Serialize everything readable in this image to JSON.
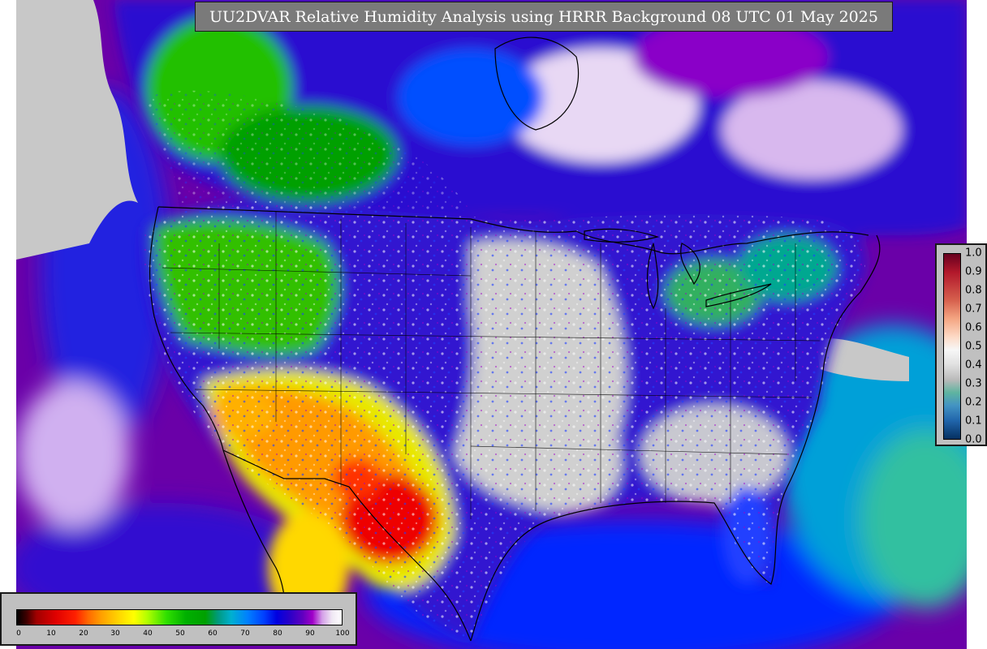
{
  "title": "UU2DVAR Relative Humidity Analysis using HRRR Background 08 UTC 01 May 2025",
  "map": {
    "variable": "Relative Humidity",
    "analysis": "UU2DVAR",
    "background": "HRRR",
    "valid_time": "08 UTC 01 May 2025",
    "region": "CONUS"
  },
  "rh_legend": {
    "ticks": [
      "0",
      "10",
      "20",
      "30",
      "40",
      "50",
      "60",
      "70",
      "80",
      "90",
      "100"
    ],
    "min": 0,
    "max": 100
  },
  "qc_legend": {
    "ticks": [
      "1.0",
      "0.9",
      "0.8",
      "0.7",
      "0.6",
      "0.5",
      "0.4",
      "0.3",
      "0.2",
      "0.1",
      "0.0"
    ],
    "min": 0.0,
    "max": 1.0
  },
  "colors": {
    "ocean_purple": "#6a00a8",
    "deep_blue": "#0000e0",
    "green": "#00b000",
    "dry_red": "#e00000",
    "orange": "#ffa000",
    "yellow": "#ffff00",
    "grey_undefined": "#c8c8c8",
    "panel_grey": "#c0c0c0",
    "title_grey": "#7a7a7a"
  }
}
